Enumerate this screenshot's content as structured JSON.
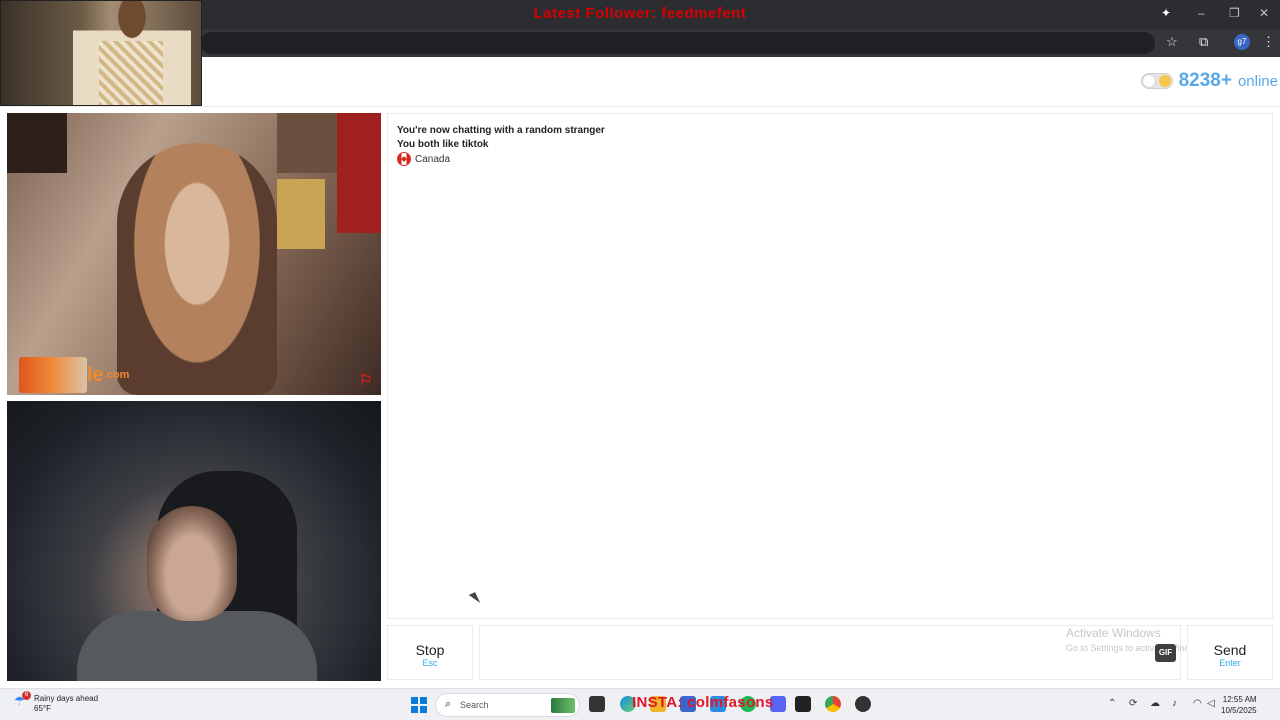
{
  "stream_overlay": {
    "banner_text": "Latest Follower: feedmefent"
  },
  "browser": {
    "window_controls": [
      "–",
      "❐",
      "✕"
    ],
    "toolbar_icons": [
      "star-icon",
      "cast-icon",
      "profile-icon",
      "menu-icon"
    ],
    "profile_initials": "g7"
  },
  "site": {
    "online_count": "8238+",
    "online_label": "online"
  },
  "video_overlay": {
    "logo_text": "le",
    "logo_domain": ".com"
  },
  "chat": {
    "messages": [
      "You're now chatting with a random stranger",
      "You both like tiktok"
    ],
    "country": "Canada"
  },
  "controls": {
    "stop_label": "Stop",
    "stop_hint": "Esc",
    "gif_label": "GIF",
    "send_label": "Send",
    "send_hint": "Enter"
  },
  "watermark": {
    "title": "Activate Windows",
    "subtitle": "Go to Settings to activate Windows."
  },
  "taskbar": {
    "weather_badge": "6",
    "weather_text": "Rainy days ahead",
    "weather_temp": "65°F",
    "search_placeholder": "Search",
    "overlay_text": "INSTA: colmfasons",
    "time": "12:55 AM",
    "date": "10/5/2025"
  },
  "colors": {
    "accent": "#5aa7e6",
    "banner": "#d50000",
    "logo": "#f28a2d"
  }
}
